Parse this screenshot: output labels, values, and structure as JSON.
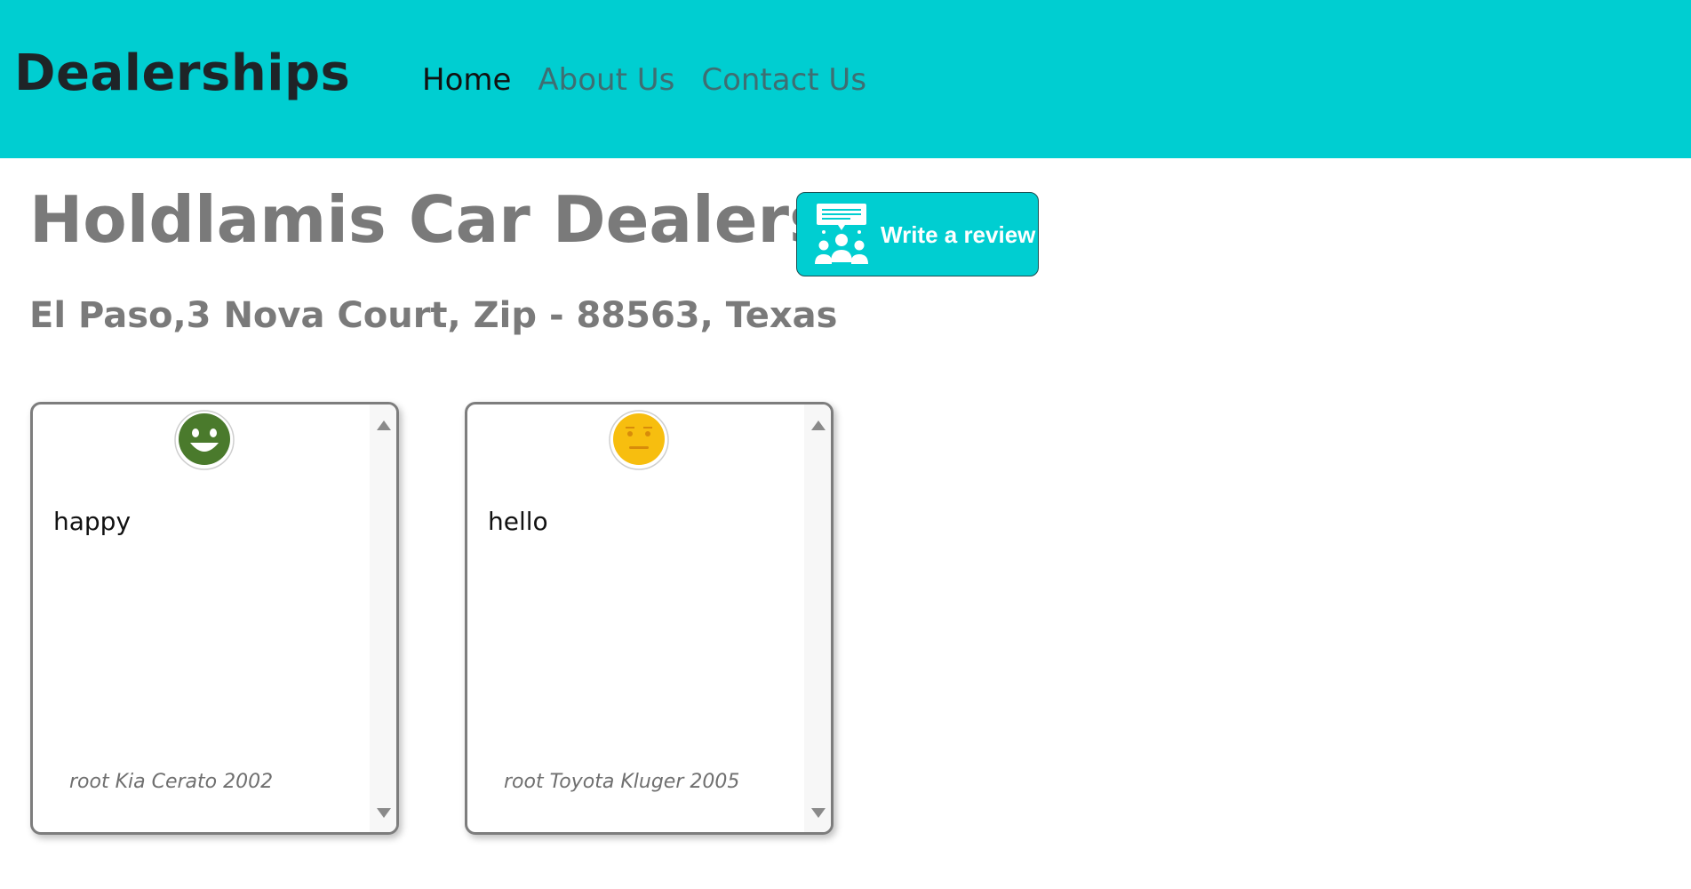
{
  "navbar": {
    "brand": "Dealerships",
    "links": [
      {
        "label": "Home"
      },
      {
        "label": "About Us"
      },
      {
        "label": "Contact Us"
      }
    ],
    "color": "#00ced1"
  },
  "dealer": {
    "name": "Holdlamis Car Dealership",
    "address": "El Paso,3 Nova Court, Zip - 88563, Texas"
  },
  "review_button": {
    "label": "Write a review",
    "icon": "review-group-icon"
  },
  "reviews": [
    {
      "sentiment": "positive",
      "icon": "happy-face-icon",
      "text": "happy",
      "reviewer": "root Kia Cerato 2002"
    },
    {
      "sentiment": "neutral",
      "icon": "neutral-face-icon",
      "text": "hello",
      "reviewer": "root Toyota Kluger 2005"
    }
  ]
}
